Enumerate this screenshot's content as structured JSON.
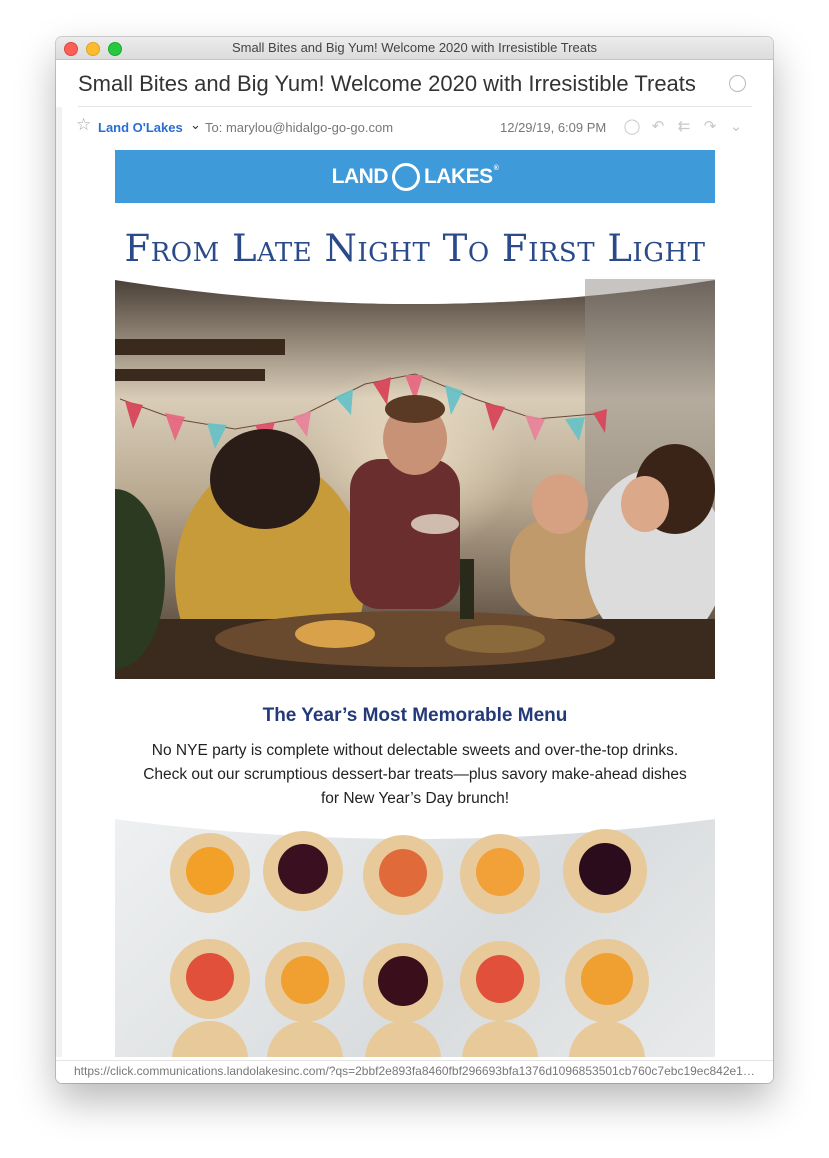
{
  "window": {
    "title": "Small Bites and Big Yum! Welcome 2020 with Irresistible Treats"
  },
  "message": {
    "subject": "Small Bites and Big Yum! Welcome 2020 with Irresistible Treats",
    "sender": "Land O'Lakes",
    "to": "To:  marylou@hidalgo-go-go.com",
    "date": "12/29/19, 6:09 PM"
  },
  "email": {
    "logo_left": "LAND",
    "logo_right": "LAKES",
    "logo_reg": "®",
    "headline": "From Late Night To First Light",
    "section_title": "The Year’s Most Memorable Menu",
    "body": "No NYE party is complete without delectable sweets and over-the-top drinks. Check out our scrumptious dessert-bar treats—plus savory make-ahead dishes for New Year’s Day brunch!"
  },
  "status_url": "https://click.communications.landolakesinc.com/?qs=2bbf2e893fa8460fbf296693bfa1376d1096853501cb760c7ebc19ec842e1…",
  "icons": [
    "star-icon",
    "chevron-down-icon",
    "speech-bubble-icon",
    "reply-icon",
    "reply-all-icon",
    "forward-icon",
    "more-chevron-icon"
  ],
  "colors": {
    "logo_bar": "#3e9ad8",
    "headline": "#2a4a8a",
    "section_title": "#243a78",
    "sender": "#2a6ed2"
  }
}
